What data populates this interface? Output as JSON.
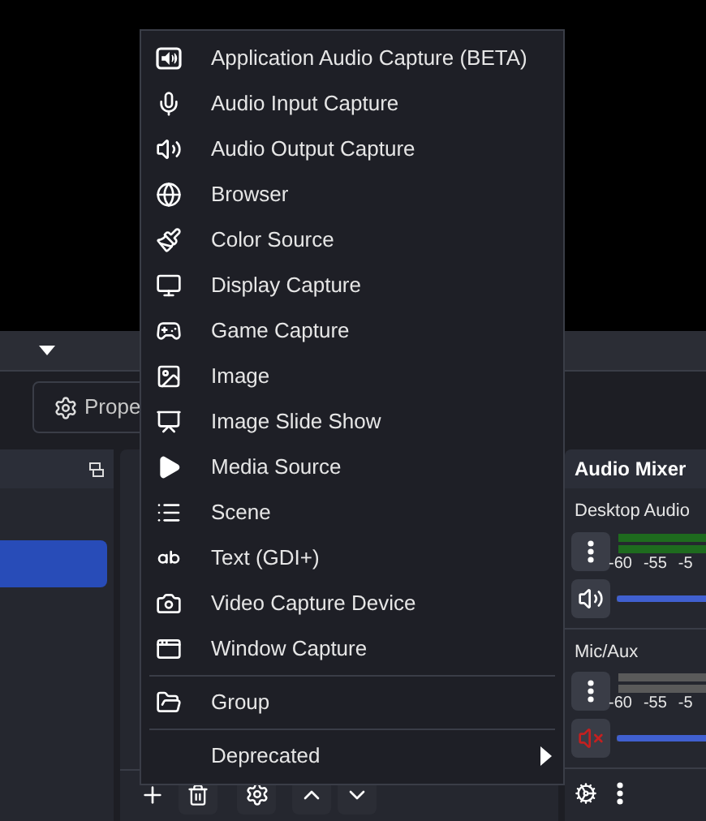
{
  "toolbar": {
    "properties_button": "Prope"
  },
  "scenes": {
    "items": [
      {
        "selected": true
      }
    ]
  },
  "audio_mixer": {
    "title": "Audio Mixer",
    "channels": [
      {
        "name": "Desktop Audio",
        "muted": false,
        "level": 1,
        "ticks": [
          "-60",
          "-55",
          "-5"
        ]
      },
      {
        "name": "Mic/Aux",
        "muted": true,
        "level": 1,
        "ticks": [
          "-60",
          "-55",
          "-5"
        ]
      }
    ]
  },
  "context_menu": {
    "items": [
      {
        "kind": "item",
        "label": "Application Audio Capture (BETA)"
      },
      {
        "kind": "item",
        "label": "Audio Input Capture"
      },
      {
        "kind": "item",
        "label": "Audio Output Capture"
      },
      {
        "kind": "item",
        "label": "Browser"
      },
      {
        "kind": "item",
        "label": "Color Source"
      },
      {
        "kind": "item",
        "label": "Display Capture"
      },
      {
        "kind": "item",
        "label": "Game Capture"
      },
      {
        "kind": "item",
        "label": "Image"
      },
      {
        "kind": "item",
        "label": "Image Slide Show"
      },
      {
        "kind": "item",
        "label": "Media Source"
      },
      {
        "kind": "item",
        "label": "Scene"
      },
      {
        "kind": "item",
        "label": "Text (GDI+)"
      },
      {
        "kind": "item",
        "label": "Video Capture Device"
      },
      {
        "kind": "item",
        "label": "Window Capture"
      },
      {
        "kind": "separator"
      },
      {
        "kind": "item",
        "label": "Group"
      },
      {
        "kind": "separator"
      },
      {
        "kind": "submenu",
        "label": "Deprecated"
      }
    ]
  }
}
